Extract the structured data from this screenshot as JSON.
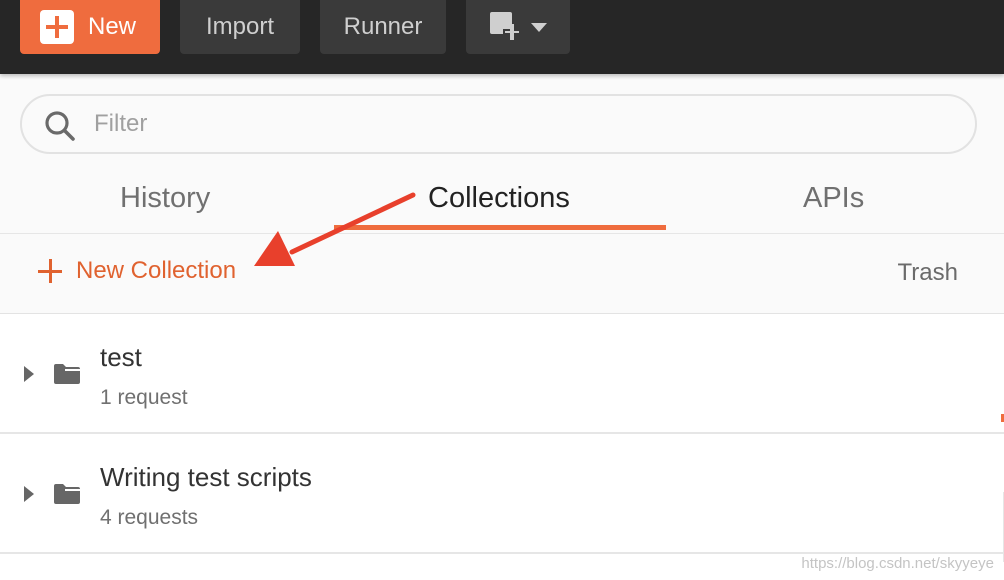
{
  "toolbar": {
    "new_label": "New",
    "import_label": "Import",
    "runner_label": "Runner"
  },
  "search": {
    "placeholder": "Filter"
  },
  "tabs": [
    {
      "label": "History"
    },
    {
      "label": "Collections",
      "active": true
    },
    {
      "label": "APIs"
    }
  ],
  "actions": {
    "new_collection_label": "New Collection",
    "trash_label": "Trash"
  },
  "collections": [
    {
      "name": "test",
      "count": "1 request"
    },
    {
      "name": "Writing test scripts",
      "count": "4 requests"
    }
  ],
  "watermark": "https://blog.csdn.net/skyyeye",
  "colors": {
    "accent": "#ef6c3e",
    "toolbar_bg": "#262626",
    "arrow": "#e8402c"
  },
  "icons": [
    "plus-icon",
    "new-window-icon",
    "chevron-down-icon",
    "search-icon",
    "caret-right-icon",
    "folder-icon"
  ]
}
